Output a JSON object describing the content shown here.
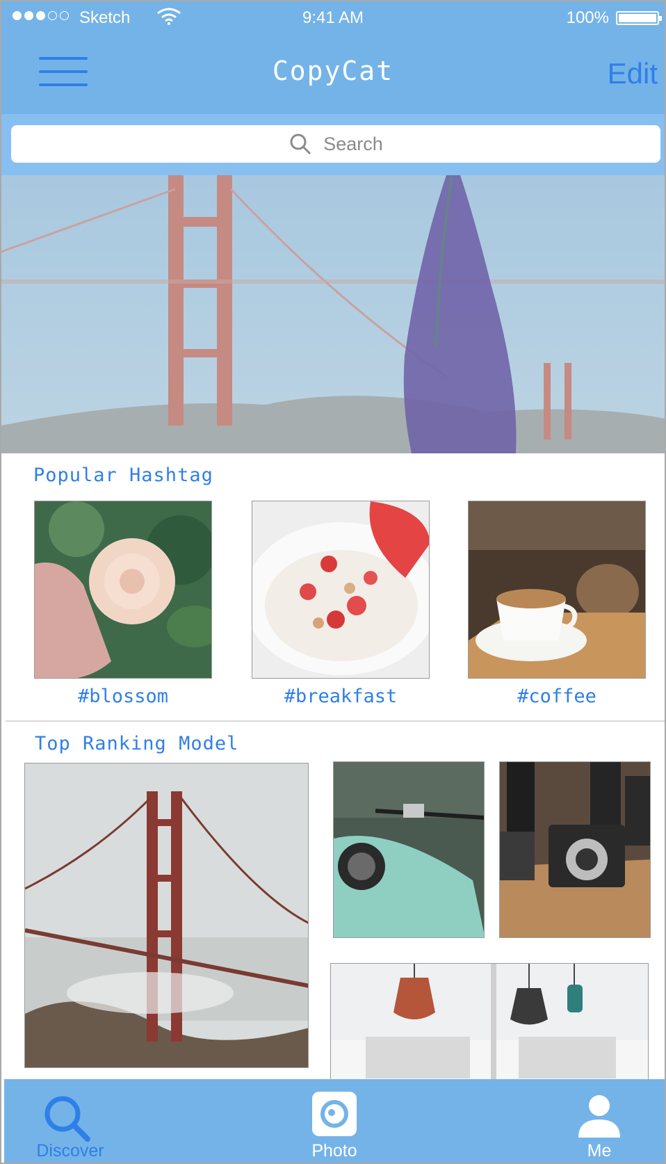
{
  "status_bar": {
    "carrier": "Sketch",
    "time": "9:41 AM",
    "battery": "100%"
  },
  "nav": {
    "title": "CopyCat",
    "edit_label": "Edit"
  },
  "search": {
    "placeholder": "Search"
  },
  "popular_hashtag": {
    "title": "Popular Hashtag",
    "items": [
      {
        "label": "#blossom"
      },
      {
        "label": "#breakfast"
      },
      {
        "label": "#coffee"
      }
    ]
  },
  "top_ranking": {
    "title": "Top Ranking Model"
  },
  "tabbar": {
    "tabs": [
      {
        "label": "Discover",
        "active": true
      },
      {
        "label": "Photo",
        "active": false
      },
      {
        "label": "Me",
        "active": false
      }
    ]
  },
  "colors": {
    "bar_blue": "#74b3e8",
    "accent_blue": "#2f7fe8",
    "white": "#ffffff"
  }
}
